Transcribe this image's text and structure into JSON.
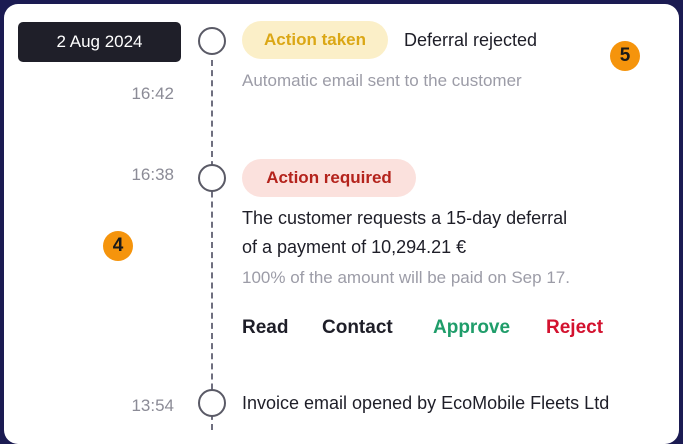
{
  "date_chip": "2 Aug 2024",
  "events": [
    {
      "time": "16:42",
      "badge": "Action taken",
      "title": "Deferral rejected",
      "detail": "Automatic email sent to the customer"
    },
    {
      "time": "16:38",
      "badge": "Action required",
      "body_line1": "The customer requests a 15-day deferral",
      "body_line2": "of a payment of 10,294.21 €",
      "detail": "100% of the amount will be paid on Sep 17.",
      "actions": {
        "read": "Read",
        "contact": "Contact",
        "approve": "Approve",
        "reject": "Reject"
      }
    },
    {
      "time": "13:54",
      "title": "Invoice email opened by EcoMobile Fleets Ltd"
    }
  ],
  "markers": {
    "left": "4",
    "right": "5"
  },
  "colors": {
    "background": "#1b1b52",
    "card": "#ffffff",
    "date_chip": "#1f1f29",
    "badge_taken_bg": "#fbefc8",
    "badge_taken_text": "#dba715",
    "badge_required_bg": "#fbe1dd",
    "badge_required_text": "#b4231c",
    "approve": "#1f9d6a",
    "reject": "#d3122f",
    "marker": "#f5940c"
  }
}
